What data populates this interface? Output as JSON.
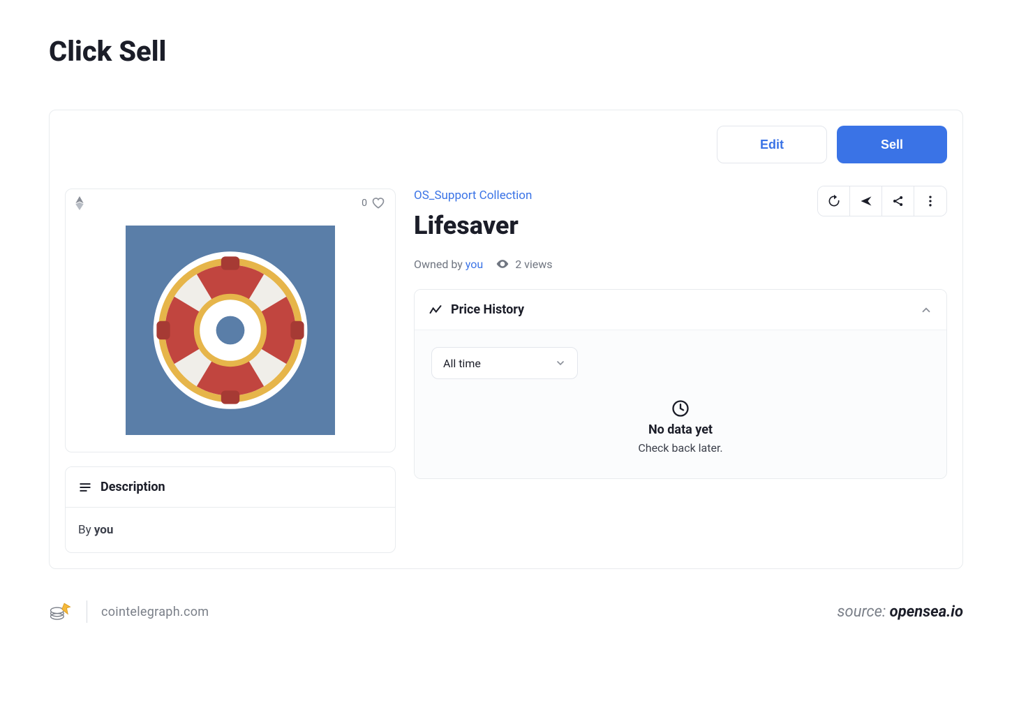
{
  "page": {
    "title": "Click Sell"
  },
  "topbar": {
    "edit_label": "Edit",
    "sell_label": "Sell"
  },
  "media": {
    "likes_count": "0"
  },
  "description": {
    "header": "Description",
    "by_prefix": "By ",
    "by_who": "you"
  },
  "nft": {
    "collection": "OS_Support Collection",
    "title": "Lifesaver",
    "owned_prefix": "Owned by ",
    "owner": "you",
    "views_text": "2 views"
  },
  "price_history": {
    "title": "Price History",
    "range": "All time",
    "empty_title": "No data yet",
    "empty_sub": "Check back later."
  },
  "footer": {
    "site": "cointelegraph.com",
    "source_label": "source: ",
    "source_value": "opensea.io"
  }
}
